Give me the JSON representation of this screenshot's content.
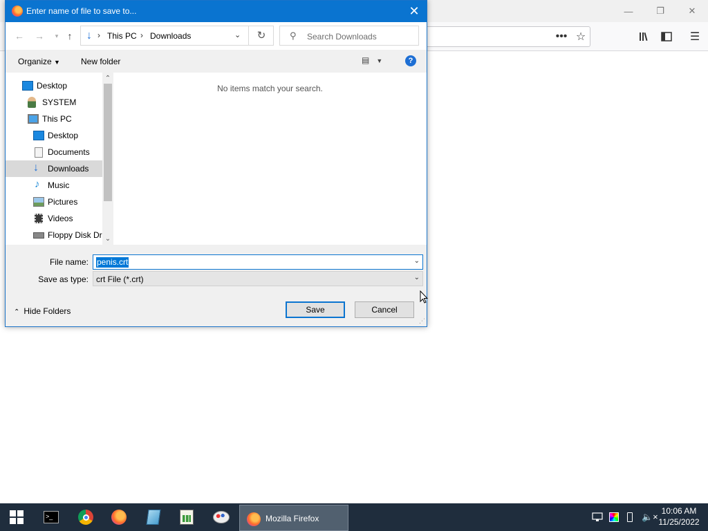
{
  "browser": {
    "url_bar_value": "",
    "icons": [
      "page-actions-icon",
      "bookmark-star-icon",
      "library-icon",
      "sidebar-icon",
      "menu-icon"
    ]
  },
  "dialog": {
    "title": "Enter name of file to save to...",
    "breadcrumb": [
      "This PC",
      "Downloads"
    ],
    "search_placeholder": "Search Downloads",
    "organize_label": "Organize",
    "new_folder_label": "New folder",
    "help_label": "?",
    "empty_message": "No items match your search.",
    "tree": [
      {
        "label": "Desktop",
        "icon": "desktop-icon"
      },
      {
        "label": "SYSTEM",
        "icon": "user-icon"
      },
      {
        "label": "This PC",
        "icon": "computer-icon"
      },
      {
        "label": "Desktop",
        "icon": "desktop-icon"
      },
      {
        "label": "Documents",
        "icon": "documents-icon"
      },
      {
        "label": "Downloads",
        "icon": "downloads-icon",
        "selected": true
      },
      {
        "label": "Music",
        "icon": "music-icon"
      },
      {
        "label": "Pictures",
        "icon": "pictures-icon"
      },
      {
        "label": "Videos",
        "icon": "videos-icon"
      },
      {
        "label": "Floppy Disk Dri",
        "icon": "floppy-icon"
      }
    ],
    "file_name_label": "File name:",
    "file_name_value": "penis.crt",
    "save_type_label": "Save as type:",
    "save_type_value": "crt File (*.crt)",
    "hide_folders_label": "Hide Folders",
    "save_label": "Save",
    "cancel_label": "Cancel"
  },
  "taskbar": {
    "active_window_label": "Mozilla Firefox",
    "pinned": [
      "terminal-icon",
      "chrome-icon",
      "firefox-icon",
      "notepad-icon",
      "spreadsheet-icon",
      "paint-icon"
    ],
    "time": "10:06 AM",
    "date": "11/25/2022"
  },
  "colors": {
    "title_bar": "#0a74d0",
    "taskbar": "#1f2d3d",
    "selection": "#0078d7"
  }
}
